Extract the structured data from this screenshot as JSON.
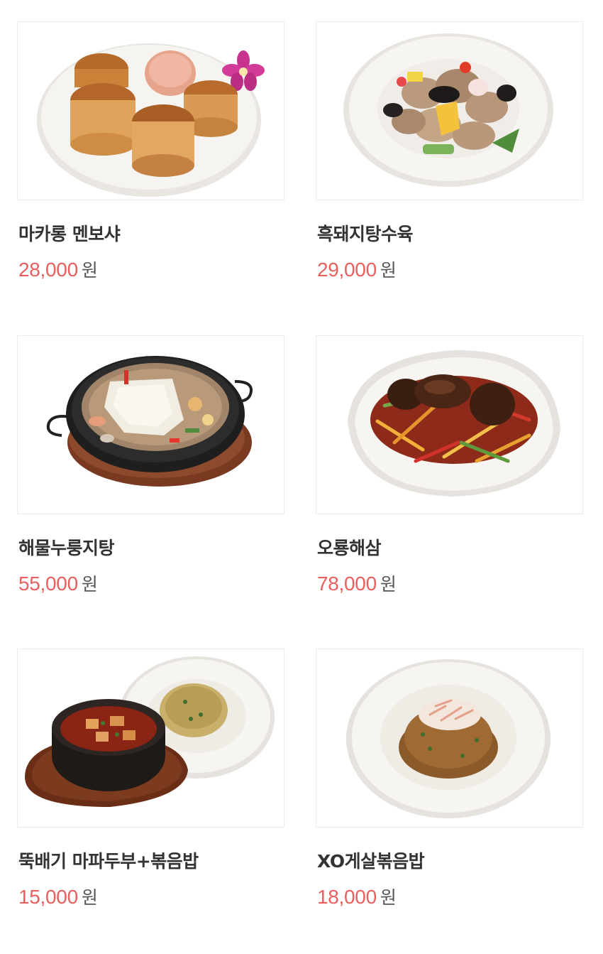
{
  "menu": {
    "items": [
      {
        "name": "마카롱 멘보샤",
        "price": "28,000",
        "currency": "원",
        "image": "fried-shrimp-toast-dish"
      },
      {
        "name": "흑돼지탕수육",
        "price": "29,000",
        "currency": "원",
        "image": "sweet-and-sour-pork-dish"
      },
      {
        "name": "해물누룽지탕",
        "price": "55,000",
        "currency": "원",
        "image": "seafood-rice-crust-soup-dish"
      },
      {
        "name": "오룡해삼",
        "price": "78,000",
        "currency": "원",
        "image": "braised-sea-cucumber-dish"
      },
      {
        "name": "뚝배기 마파두부+볶음밥",
        "price": "15,000",
        "currency": "원",
        "image": "mapo-tofu-fried-rice-dish"
      },
      {
        "name": "XO게살볶음밥",
        "price": "18,000",
        "currency": "원",
        "image": "xo-crab-fried-rice-dish"
      }
    ]
  },
  "colors": {
    "price": "#e8605e",
    "name": "#333333",
    "currency": "#555555",
    "thumb_border": "#ececec"
  }
}
